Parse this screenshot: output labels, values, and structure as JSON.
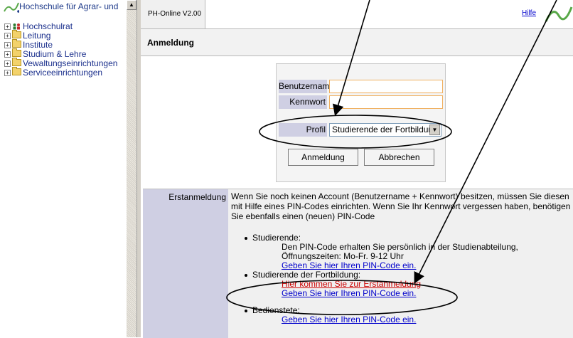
{
  "tree": {
    "title": "Hochschule für Agrar- und",
    "items": [
      {
        "label": "Hochschulrat",
        "icon": "people-icon"
      },
      {
        "label": "Leitung",
        "icon": "folder-icon"
      },
      {
        "label": "Institute",
        "icon": "folder-icon"
      },
      {
        "label": "Studium & Lehre",
        "icon": "folder-icon"
      },
      {
        "label": "Vewaltungseinrichtungen",
        "icon": "folder-icon"
      },
      {
        "label": "Serviceeinrichtungen",
        "icon": "folder-icon"
      }
    ]
  },
  "topbar": {
    "tab": "PH-Online V2.00",
    "help": "Hilfe"
  },
  "header": {
    "title": "Anmeldung"
  },
  "login": {
    "username_label": "Benutzername",
    "username_value": "",
    "password_label": "Kennwort",
    "password_value": "",
    "profile_label": "Profil",
    "profile_value": "Studierende der Fortbildung",
    "login_button": "Anmeldung",
    "cancel_button": "Abbrechen"
  },
  "info": {
    "section_label": "Erstanmeldung",
    "intro": "Wenn Sie noch keinen Account (Benutzername + Kennwort) besitzen, müssen Sie diesen mit Hilfe eines PIN-Codes einrichten. Wenn Sie Ihr Kennwort vergessen haben, benötigen Sie ebenfalls einen (neuen) PIN-Code",
    "students_title": "Studierende:",
    "students_text": "Den PIN-Code erhalten Sie persönlich in der Studienabteilung, Öffnungszeiten: Mo-Fr. 9-12 Uhr",
    "students_link": "Geben Sie hier Ihren PIN-Code ein.",
    "cont_title": "Studierende der Fortbildung:",
    "cont_link_first": "Hier kommen Sie zur Erstanmeldung",
    "cont_link_pin": "Geben Sie hier Ihren PIN-Code ein.",
    "staff_title": "Bedienstete:",
    "staff_link": "Geben Sie hier Ihren PIN-Code ein."
  },
  "colors": {
    "label_bg": "#cfcfe3",
    "link": "#0000cc",
    "link_red": "#cc0000",
    "input_border": "#f0b060"
  }
}
